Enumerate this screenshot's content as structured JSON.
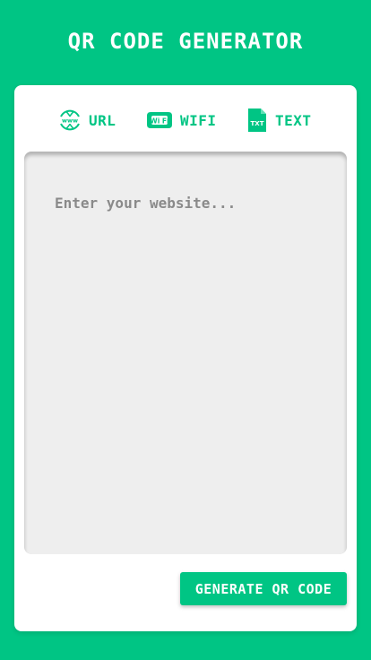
{
  "app": {
    "title": "QR CODE GENERATOR"
  },
  "tabs": [
    {
      "label": "URL",
      "icon": "www-globe-icon"
    },
    {
      "label": "WIFI",
      "icon": "wifi-icon"
    },
    {
      "label": "TEXT",
      "icon": "txt-file-icon"
    }
  ],
  "input": {
    "value": "",
    "placeholder": "Enter your website..."
  },
  "generate_button": {
    "label": "GENERATE QR CODE"
  },
  "colors": {
    "accent": "#00c584",
    "card": "#ffffff",
    "input_bg": "#eeeeee",
    "placeholder": "#8a8a8a"
  }
}
